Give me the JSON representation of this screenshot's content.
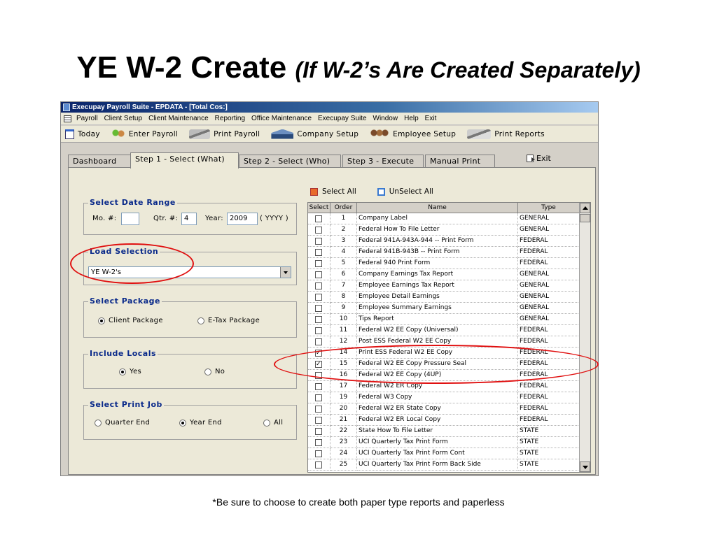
{
  "slide": {
    "title": "YE W-2 Create",
    "subtitle": "(If W-2’s Are Created Separately)",
    "footnote": "*Be sure to choose to create both paper type reports and paperless"
  },
  "window": {
    "title": "Execupay Payroll Suite - EPDATA - [Total Cos:]"
  },
  "menu": [
    "Payroll",
    "Client Setup",
    "Client Maintenance",
    "Reporting",
    "Office Maintenance",
    "Execupay Suite",
    "Window",
    "Help",
    "Exit"
  ],
  "toolbar": {
    "today": "Today",
    "enter_payroll": "Enter Payroll",
    "print_payroll": "Print Payroll",
    "company_setup": "Company Setup",
    "employee_setup": "Employee Setup",
    "print_reports": "Print Reports"
  },
  "tabs": {
    "dashboard": "Dashboard",
    "step1": "Step 1 - Select (What)",
    "step2": "Step 2 - Select (Who)",
    "step3": "Step 3 - Execute",
    "manual": "Manual Print"
  },
  "exit_label": "Exit",
  "date_range": {
    "title": "Select Date Range",
    "mo_label": "Mo. #:",
    "mo_value": "",
    "qtr_label": "Qtr. #:",
    "qtr_value": "4",
    "year_label": "Year:",
    "year_value": "2009",
    "year_hint": "( YYYY )"
  },
  "load_selection": {
    "title": "Load Selection",
    "value": "YE W-2's"
  },
  "package": {
    "title": "Select Package",
    "client": "Client Package",
    "etax": "E-Tax Package",
    "selected": "client"
  },
  "locals": {
    "title": "Include Locals",
    "yes": "Yes",
    "no": "No",
    "selected": "yes"
  },
  "print_job": {
    "title": "Select Print Job",
    "quarter_end": "Quarter End",
    "year_end": "Year End",
    "all": "All",
    "selected": "year_end"
  },
  "select_all": "Select All",
  "unselect_all": "UnSelect All",
  "grid": {
    "headers": [
      "Select",
      "Order",
      "Name",
      "Type"
    ],
    "rows": [
      {
        "checked": false,
        "order": "1",
        "name": "Company Label",
        "type": "GENERAL"
      },
      {
        "checked": false,
        "order": "2",
        "name": "Federal How To File Letter",
        "type": "GENERAL"
      },
      {
        "checked": false,
        "order": "3",
        "name": "Federal 941A-943A-944 -- Print Form",
        "type": "FEDERAL"
      },
      {
        "checked": false,
        "order": "4",
        "name": "Federal 941B-943B -- Print Form",
        "type": "FEDERAL"
      },
      {
        "checked": false,
        "order": "5",
        "name": "Federal 940 Print Form",
        "type": "FEDERAL"
      },
      {
        "checked": false,
        "order": "6",
        "name": "Company Earnings Tax Report",
        "type": "GENERAL"
      },
      {
        "checked": false,
        "order": "7",
        "name": "Employee Earnings Tax Report",
        "type": "GENERAL"
      },
      {
        "checked": false,
        "order": "8",
        "name": "Employee Detail Earnings",
        "type": "GENERAL"
      },
      {
        "checked": false,
        "order": "9",
        "name": "Employee Summary Earnings",
        "type": "GENERAL"
      },
      {
        "checked": false,
        "order": "10",
        "name": "Tips Report",
        "type": "GENERAL"
      },
      {
        "checked": false,
        "order": "11",
        "name": "Federal W2 EE Copy (Universal)",
        "type": "FEDERAL"
      },
      {
        "checked": false,
        "order": "12",
        "name": "Post ESS Federal W2 EE Copy",
        "type": "FEDERAL"
      },
      {
        "checked": true,
        "order": "14",
        "name": "Print ESS Federal W2 EE Copy",
        "type": "FEDERAL"
      },
      {
        "checked": true,
        "order": "15",
        "name": "Federal W2 EE Copy Pressure Seal",
        "type": "FEDERAL"
      },
      {
        "checked": false,
        "order": "16",
        "name": "Federal W2 EE Copy (4UP)",
        "type": "FEDERAL"
      },
      {
        "checked": false,
        "order": "17",
        "name": "Federal W2 ER Copy",
        "type": "FEDERAL"
      },
      {
        "checked": false,
        "order": "19",
        "name": "Federal W3 Copy",
        "type": "FEDERAL"
      },
      {
        "checked": false,
        "order": "20",
        "name": "Federal W2 ER State Copy",
        "type": "FEDERAL"
      },
      {
        "checked": false,
        "order": "21",
        "name": "Federal W2 ER Local Copy",
        "type": "FEDERAL"
      },
      {
        "checked": false,
        "order": "22",
        "name": "State How To File Letter",
        "type": "STATE"
      },
      {
        "checked": false,
        "order": "23",
        "name": "UCI Quarterly Tax Print Form",
        "type": "STATE"
      },
      {
        "checked": false,
        "order": "24",
        "name": "UCI Quarterly Tax Print Form Cont",
        "type": "STATE"
      },
      {
        "checked": false,
        "order": "25",
        "name": "UCI Quarterly Tax Print Form Back Side",
        "type": "STATE"
      }
    ]
  },
  "colors": {
    "highlight_ring": "#e01010",
    "group_title": "#0a2a8a",
    "titlebar": "#0a246a"
  }
}
